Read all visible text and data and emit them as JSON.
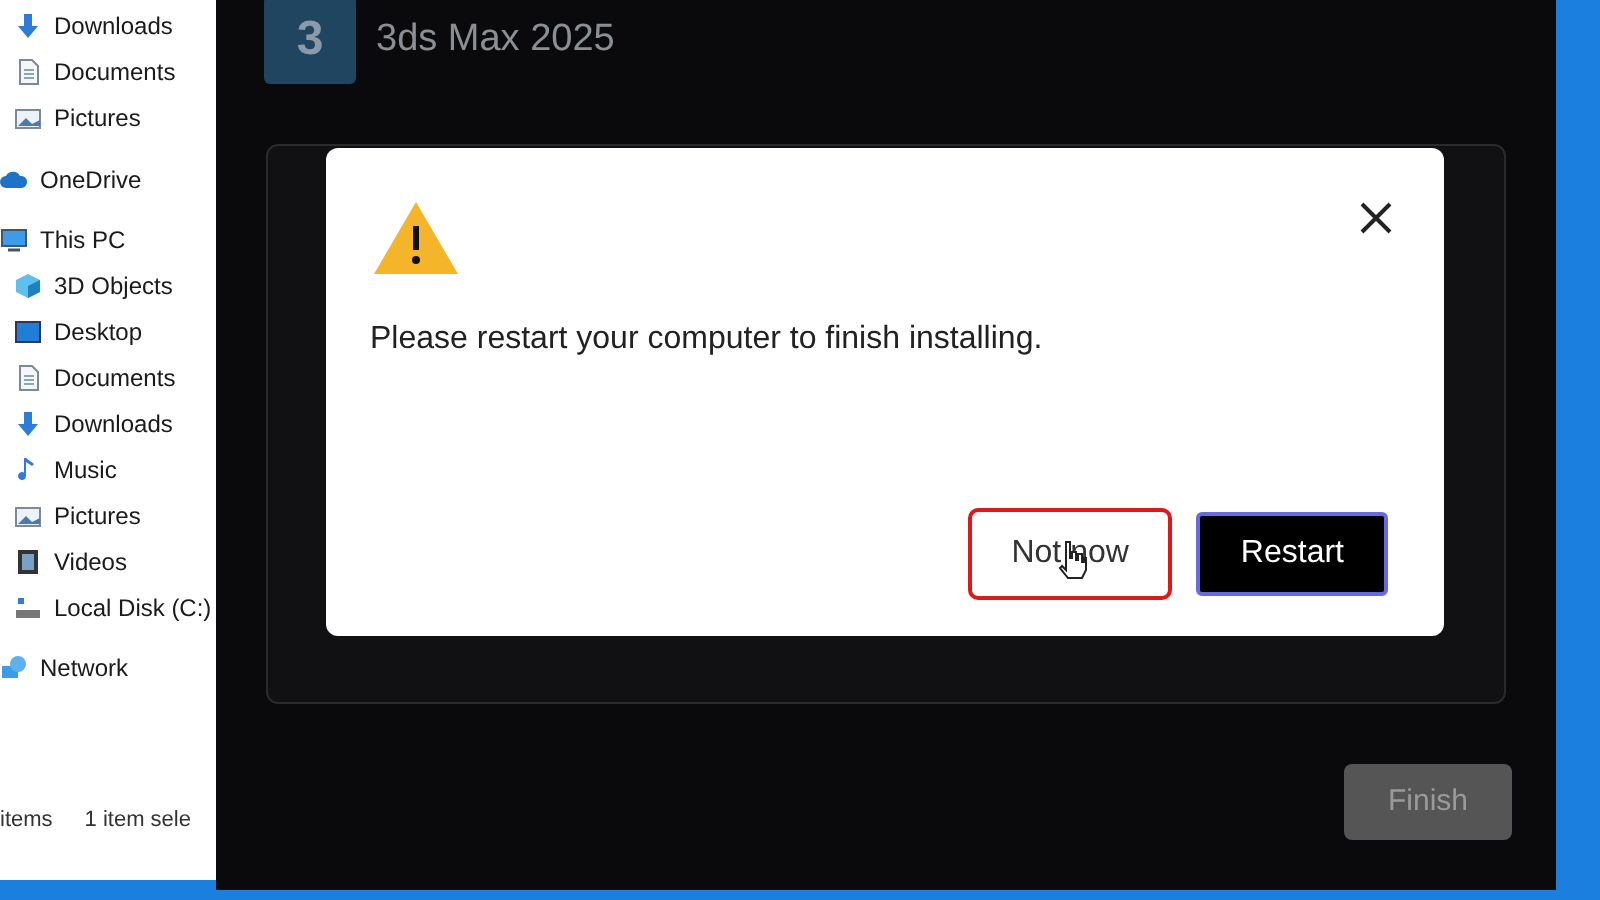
{
  "explorer": {
    "quick_access": [
      {
        "label": "Downloads",
        "kind": "download"
      },
      {
        "label": "Documents",
        "kind": "document"
      },
      {
        "label": "Pictures",
        "kind": "pictures"
      }
    ],
    "nav": [
      {
        "label": "OneDrive",
        "kind": "cloud"
      },
      {
        "label": "This PC",
        "kind": "pc",
        "children": [
          {
            "label": "3D Objects",
            "kind": "cube"
          },
          {
            "label": "Desktop",
            "kind": "desktop"
          },
          {
            "label": "Documents",
            "kind": "document"
          },
          {
            "label": "Downloads",
            "kind": "download"
          },
          {
            "label": "Music",
            "kind": "music"
          },
          {
            "label": "Pictures",
            "kind": "pictures"
          },
          {
            "label": "Videos",
            "kind": "video"
          },
          {
            "label": "Local Disk (C:)",
            "kind": "disk"
          }
        ]
      },
      {
        "label": "Network",
        "kind": "network"
      }
    ],
    "status_bar": [
      "items",
      "1 item sele"
    ]
  },
  "installer": {
    "logo": "3",
    "title": "3ds Max 2025",
    "finish": {
      "label": "Finish",
      "disabled": true
    }
  },
  "dialog": {
    "message": "Please restart your computer to finish installing.",
    "buttons": [
      {
        "label": "Not now",
        "kind": "secondary",
        "highlighted": true
      },
      {
        "label": "Restart",
        "kind": "primary",
        "highlighted": false
      }
    ]
  }
}
